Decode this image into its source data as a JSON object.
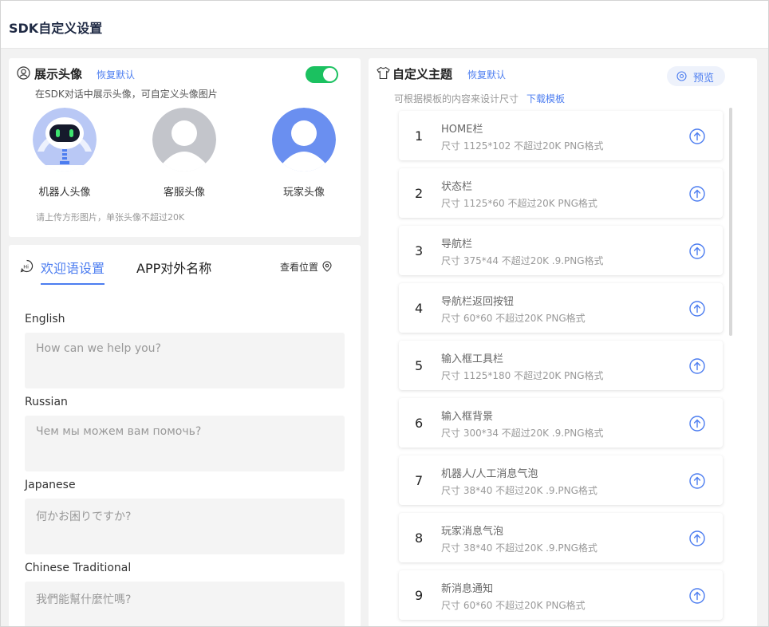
{
  "header": {
    "title": "SDK自定义设置"
  },
  "avatar_section": {
    "title": "展示头像",
    "reset_link": "恢复默认",
    "description": "在SDK对话中展示头像，可自定义头像图片",
    "toggle_on": true,
    "avatars": [
      {
        "label": "机器人头像",
        "icon": "robot-avatar-icon"
      },
      {
        "label": "客服头像",
        "icon": "agent-avatar-icon"
      },
      {
        "label": "玩家头像",
        "icon": "player-avatar-icon"
      }
    ],
    "hint": "请上传方形图片，单张头像不超过20K"
  },
  "welcome_section": {
    "tabs": [
      {
        "label": "欢迎语设置",
        "active": true
      },
      {
        "label": "APP对外名称",
        "active": false
      }
    ],
    "view_position": "查看位置",
    "fields": [
      {
        "label": "English",
        "placeholder": "How can we help you?"
      },
      {
        "label": "Russian",
        "placeholder": "Чем мы можем вам помочь?"
      },
      {
        "label": "Japanese",
        "placeholder": "何かお困りですか?"
      },
      {
        "label": "Chinese Traditional",
        "placeholder": "我們能幫什麼忙嗎?"
      }
    ]
  },
  "theme_section": {
    "title": "自定义主题",
    "reset_link": "恢复默认",
    "preview_button": "预览",
    "description": "可根据模板的内容来设计尺寸",
    "download_link": "下载模板",
    "items": [
      {
        "num": "1",
        "name": "HOME栏",
        "spec": "尺寸 1125*102 不超过20K PNG格式"
      },
      {
        "num": "2",
        "name": "状态栏",
        "spec": "尺寸 1125*60 不超过20K PNG格式"
      },
      {
        "num": "3",
        "name": "导航栏",
        "spec": "尺寸 375*44 不超过20K .9.PNG格式"
      },
      {
        "num": "4",
        "name": "导航栏返回按钮",
        "spec": "尺寸 60*60 不超过20K PNG格式"
      },
      {
        "num": "5",
        "name": "输入框工具栏",
        "spec": "尺寸 1125*180 不超过20K PNG格式"
      },
      {
        "num": "6",
        "name": "输入框背景",
        "spec": "尺寸 300*34 不超过20K .9.PNG格式"
      },
      {
        "num": "7",
        "name": "机器人/人工消息气泡",
        "spec": "尺寸 38*40 不超过20K .9.PNG格式"
      },
      {
        "num": "8",
        "name": "玩家消息气泡",
        "spec": "尺寸 38*40 不超过20K .9.PNG格式"
      },
      {
        "num": "9",
        "name": "新消息通知",
        "spec": "尺寸 60*60 不超过20K PNG格式"
      }
    ]
  },
  "colors": {
    "accent": "#4c7df0",
    "toggle": "#1bc160",
    "background": "#f2f2f2"
  }
}
